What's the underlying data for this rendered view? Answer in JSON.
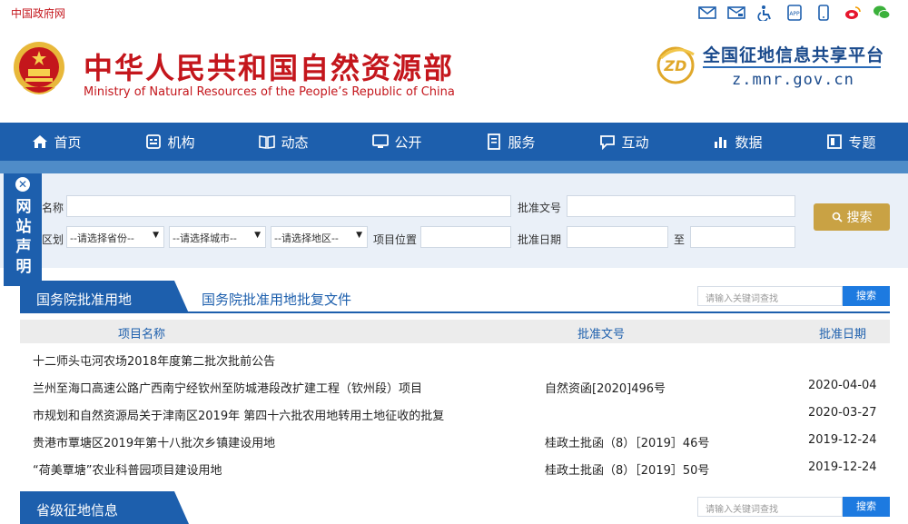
{
  "topbar": {
    "gov_link": "中国政府网",
    "icons": [
      "mail-icon",
      "message-icon",
      "accessibility-icon",
      "app-icon",
      "mobile-icon",
      "weibo-icon",
      "wechat-icon"
    ]
  },
  "header": {
    "cn_title": "中华人民共和国自然资源部",
    "en_title": "Ministry of Natural Resources of the People’s Republic of China",
    "platform_title": "全国征地信息共享平台",
    "platform_url": "z.mnr.gov.cn"
  },
  "nav": {
    "items": [
      {
        "label": "首页",
        "icon": "home-icon"
      },
      {
        "label": "机构",
        "icon": "org-icon"
      },
      {
        "label": "动态",
        "icon": "book-icon"
      },
      {
        "label": "公开",
        "icon": "screen-icon"
      },
      {
        "label": "服务",
        "icon": "document-icon"
      },
      {
        "label": "互动",
        "icon": "chat-icon"
      },
      {
        "label": "数据",
        "icon": "bar-chart-icon"
      },
      {
        "label": "专题",
        "icon": "topic-icon"
      }
    ]
  },
  "side_notice": {
    "text": "网站声明",
    "close": "✕"
  },
  "search": {
    "name_label": "名称",
    "approval_no_label": "批准文号",
    "region_label": "区划",
    "province_select": "--请选择省份--",
    "city_select": "--请选择城市--",
    "district_select": "--请选择地区--",
    "location_label": "项目位置",
    "date_label": "批准日期",
    "to_label": "至",
    "button": "搜索"
  },
  "section1": {
    "active_tab": "国务院批准用地",
    "link_tab": "国务院批准用地批复文件",
    "keyword_placeholder": "请输入关键词查找",
    "keyword_button": "搜索"
  },
  "table": {
    "headers": {
      "name": "项目名称",
      "number": "批准文号",
      "date": "批准日期"
    },
    "rows": [
      {
        "name": "十二师头屯河农场2018年度第二批次批前公告",
        "number": "",
        "date": ""
      },
      {
        "name": "兰州至海口高速公路广西南宁经钦州至防城港段改扩建工程（钦州段）项目",
        "number": "自然资函[2020]496号",
        "date": "2020-04-04"
      },
      {
        "name": "市规划和自然资源局关于津南区2019年 第四十六批农用地转用土地征收的批复",
        "number": "",
        "date": "2020-03-27"
      },
      {
        "name": "贵港市覃塘区2019年第十八批次乡镇建设用地",
        "number": "桂政土批函（8）［2019］46号",
        "date": "2019-12-24"
      },
      {
        "name": "“荷美覃塘”农业科普园项目建设用地",
        "number": "桂政土批函（8）［2019］50号",
        "date": "2019-12-24"
      }
    ]
  },
  "section2": {
    "active_tab": "省级征地信息",
    "keyword_placeholder": "请输入关键词查找",
    "keyword_button": "搜索"
  }
}
